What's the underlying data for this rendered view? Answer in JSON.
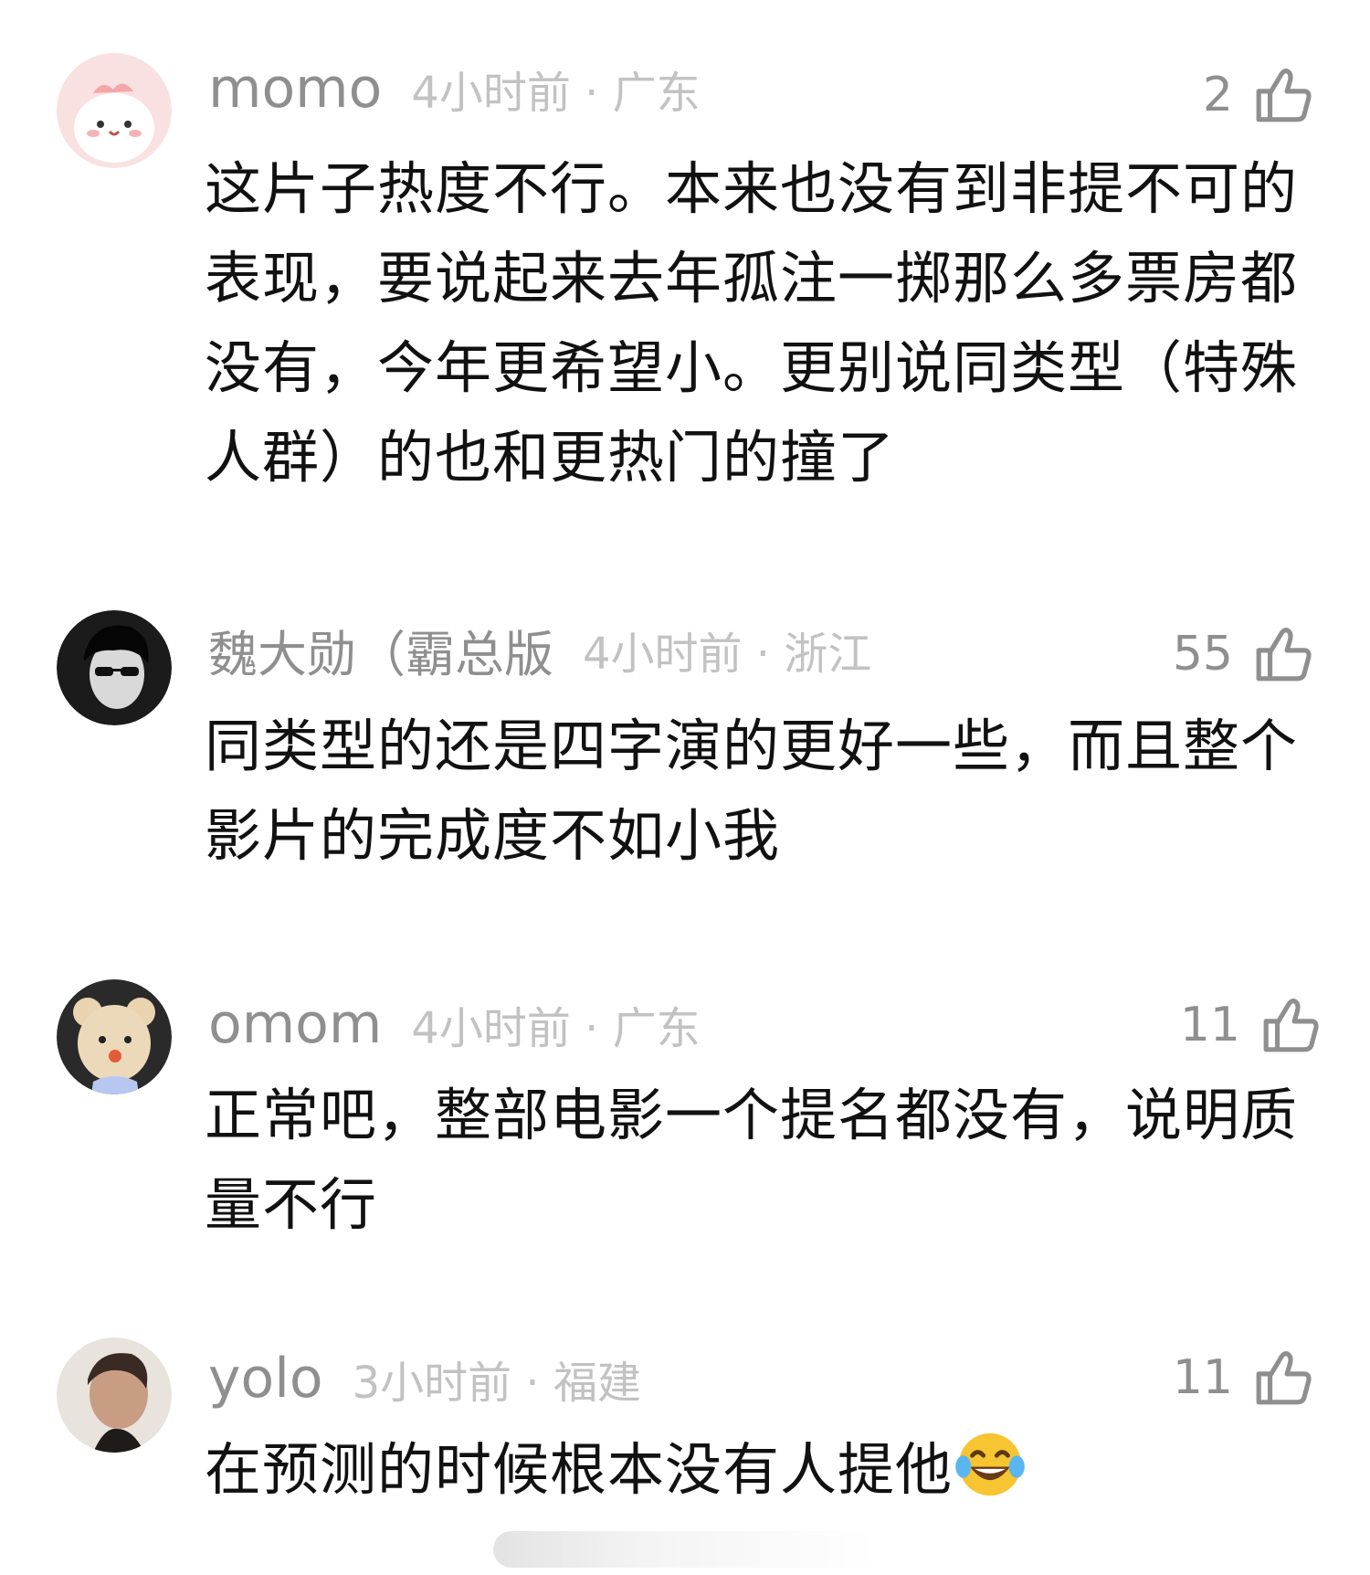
{
  "comments": [
    {
      "username": "momo",
      "time": "4小时前",
      "location": "广东",
      "likes": "2",
      "text": "这片子热度不行。本来也没有到非提不可的表现，要说起来去年孤注一掷那么多票房都没有，今年更希望小。更别说同类型（特殊人群）的也和更热门的撞了",
      "avatar_icon": "pink-cartoon-avatar"
    },
    {
      "username": "魏大勋（霸总版",
      "time": "4小时前",
      "location": "浙江",
      "likes": "55",
      "text": "同类型的还是四字演的更好一些，而且整个影片的完成度不如小我",
      "avatar_icon": "man-sunglasses-avatar"
    },
    {
      "username": "omom",
      "time": "4小时前",
      "location": "广东",
      "likes": "11",
      "text": "正常吧，整部电影一个提名都没有，说明质量不行",
      "avatar_icon": "teddy-bear-avatar"
    },
    {
      "username": "yolo",
      "time": "3小时前",
      "location": "福建",
      "likes": "11",
      "text": "在预测的时候根本没有人提他",
      "avatar_icon": "man-portrait-avatar",
      "trailing_emoji": "laughing-crying-emoji"
    }
  ],
  "separator": " · ",
  "colors": {
    "meta_text": "#8f8f8f",
    "time_text": "#c2c2c2",
    "body_text": "#111111",
    "background": "#ffffff"
  }
}
